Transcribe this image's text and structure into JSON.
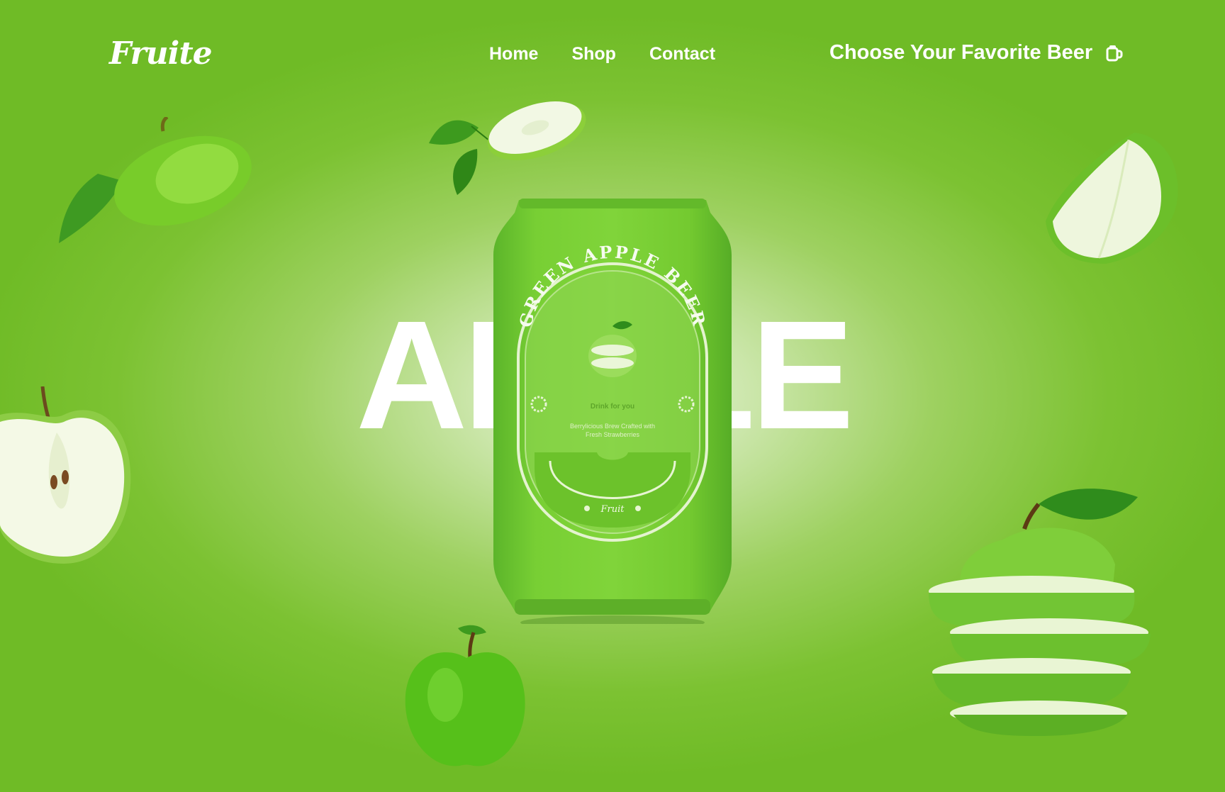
{
  "brand": {
    "logo": "Fruite"
  },
  "nav": {
    "items": [
      "Home",
      "Shop",
      "Contact"
    ]
  },
  "cta": {
    "label": "Choose Your Favorite Beer",
    "icon": "beer-mug-icon"
  },
  "hero": {
    "word": "APPLE"
  },
  "can_label": {
    "title": "GREEN APPLE BEER",
    "tagline": "Drink for you",
    "description_line1": "Berrylicious Brew Crafted with",
    "description_line2": "Fresh Strawberries",
    "brand": "Fruit"
  },
  "colors": {
    "accent": "#7cc232",
    "can": "#75cc2e",
    "text": "#ffffff"
  }
}
